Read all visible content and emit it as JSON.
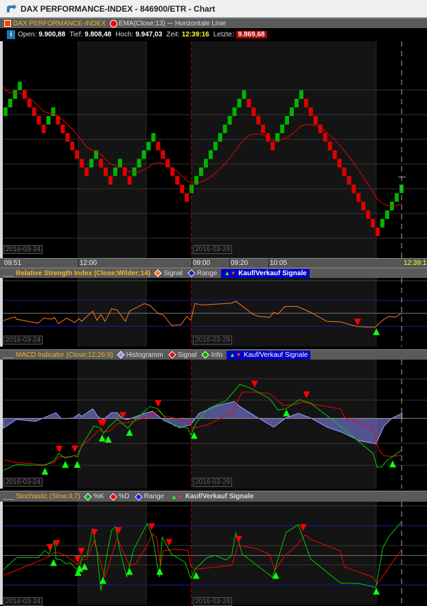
{
  "window": {
    "title": "DAX PERFORMANCE-INDEX - 846900/ETR - Chart"
  },
  "legend": {
    "instrument": "DAX PERFORMANCE-INDEX",
    "ema": "EMA(Close;13)",
    "hline": "Horizontale Linie",
    "colors": {
      "instrument": "#ff4400",
      "ema": "#ff0000",
      "hline": "#5aa0d0"
    }
  },
  "info": {
    "open_label": "Open:",
    "open": "9.900,88",
    "low_label": "Tief:",
    "low": "9.808,48",
    "high_label": "Hoch:",
    "high": "9.947,03",
    "time_label": "Zeit:",
    "time": "12:39:16",
    "last_label": "Letzte:",
    "last": "9.869,68"
  },
  "dates": {
    "d1": "2016-03-24",
    "d2": "2016-03-29"
  },
  "time_axis": [
    "09:51",
    "12:00",
    "09:00",
    "09:20",
    "10:05",
    "12:39:1"
  ],
  "renko": {
    "start_level": -3,
    "runs": [
      [
        1,
        4
      ],
      [
        -1,
        5
      ],
      [
        1,
        2
      ],
      [
        -1,
        7
      ],
      [
        1,
        2
      ],
      [
        -1,
        3
      ],
      [
        1,
        2
      ],
      [
        -1,
        2
      ],
      [
        1,
        5
      ],
      [
        -1,
        7
      ],
      [
        1,
        12
      ],
      [
        -1,
        6
      ],
      [
        1,
        6
      ],
      [
        -1,
        16
      ],
      [
        1,
        5
      ]
    ],
    "up_color": "#00b400",
    "down_color": "#e00000",
    "ema_period": 13
  },
  "rsi": {
    "title": "Relative Strength Index (Close;Wilder;14)",
    "signal": "Signal",
    "range": "Range",
    "signals": "Kauf/Verkauf Signale",
    "range_levels": [
      30,
      70
    ],
    "series": [
      [
        0.8,
        38.8
      ],
      [
        3.7,
        44.4
      ],
      [
        4,
        40.9
      ],
      [
        9.3,
        34.6
      ],
      [
        10.7,
        42.3
      ],
      [
        12.7,
        40.9
      ],
      [
        13.3,
        43.7
      ],
      [
        14.3,
        33.9
      ],
      [
        16.3,
        42.3
      ],
      [
        18.3,
        35.6
      ],
      [
        19.3,
        41.6
      ],
      [
        20,
        37.4
      ],
      [
        22.7,
        53.2
      ],
      [
        23.7,
        39.1
      ],
      [
        24.7,
        47.9
      ],
      [
        25.7,
        37.4
      ],
      [
        27.3,
        56.7
      ],
      [
        28.7,
        54.9
      ],
      [
        30.7,
        37.4
      ],
      [
        31.7,
        53.2
      ],
      [
        35.3,
        64.7
      ],
      [
        36.7,
        61.9
      ],
      [
        38.7,
        49.6
      ],
      [
        40,
        47.2
      ],
      [
        42,
        31.1
      ],
      [
        44.3,
        32.1
      ],
      [
        45.7,
        45.1
      ],
      [
        46.7,
        39.1
      ],
      [
        47.7,
        64.7
      ],
      [
        49.7,
        62.6
      ],
      [
        56.7,
        65.4
      ],
      [
        57.7,
        68.2
      ],
      [
        58.7,
        63.7
      ],
      [
        62,
        47.9
      ],
      [
        63.3,
        45.1
      ],
      [
        66,
        43.7
      ],
      [
        67,
        51.4
      ],
      [
        68,
        48.6
      ],
      [
        69.7,
        60.2
      ],
      [
        72.7,
        60.5
      ],
      [
        76,
        51.4
      ],
      [
        80,
        37.4
      ],
      [
        83.3,
        36.7
      ],
      [
        87.3,
        29.6
      ],
      [
        91.7,
        28.2
      ],
      [
        92.7,
        33.9
      ],
      [
        94,
        40.9
      ],
      [
        95.3,
        45.1
      ],
      [
        96.7,
        43.7
      ],
      [
        98.4,
        50.4
      ]
    ],
    "markers": [
      {
        "idx": 87.5,
        "value": 30,
        "type": "sell"
      },
      {
        "idx": 92.1,
        "value": 28,
        "type": "buy"
      }
    ]
  },
  "macd": {
    "title": "MACD Indicator (Close;12;26;9)",
    "histogram": "Histogramm",
    "signal": "Signal",
    "info": "Info",
    "signals": "Kauf/Verkauf Signale",
    "histogram_series": [
      [
        0.8,
        -4.3
      ],
      [
        4,
        -0.5
      ],
      [
        8.7,
        -1.3
      ],
      [
        11.3,
        0.7
      ],
      [
        13.7,
        2.5
      ],
      [
        15,
        -0.1
      ],
      [
        18,
        0.2
      ],
      [
        19.3,
        1.9
      ],
      [
        20,
        0.9
      ],
      [
        22.7,
        4.2
      ],
      [
        24,
        0.7
      ],
      [
        25.3,
        -0.5
      ],
      [
        27.3,
        2.5
      ],
      [
        28.7,
        2.5
      ],
      [
        30,
        -0.1
      ],
      [
        31.3,
        -0.5
      ],
      [
        35.3,
        2.2
      ],
      [
        37.3,
        3.2
      ],
      [
        40,
        -0.8
      ],
      [
        44,
        -4.1
      ],
      [
        46.7,
        -2.8
      ],
      [
        48.7,
        2.2
      ],
      [
        53.3,
        5.7
      ],
      [
        57.3,
        7.4
      ],
      [
        58.7,
        5.2
      ],
      [
        62.7,
        0.7
      ],
      [
        67,
        -3.8
      ],
      [
        70,
        0.2
      ],
      [
        73,
        2.2
      ],
      [
        76,
        0.2
      ],
      [
        80,
        -3.8
      ],
      [
        84,
        -6.3
      ],
      [
        88,
        -9.8
      ],
      [
        92,
        -11.1
      ],
      [
        94,
        -3.3
      ],
      [
        96,
        0.2
      ],
      [
        98.4,
        2.2
      ]
    ],
    "signal_series": [
      [
        0.8,
        -18
      ],
      [
        4,
        -19.3
      ],
      [
        10.7,
        -20.3
      ],
      [
        13.3,
        -19.3
      ],
      [
        14.3,
        -16.8
      ],
      [
        17.3,
        -16.8
      ],
      [
        19,
        -15.8
      ],
      [
        20,
        -12.3
      ],
      [
        23,
        -7.3
      ],
      [
        24,
        -5.3
      ],
      [
        26.7,
        -5.8
      ],
      [
        28.7,
        -2.3
      ],
      [
        31.3,
        -1.8
      ],
      [
        35.3,
        0.2
      ],
      [
        37.3,
        1.7
      ],
      [
        38.7,
        3.5
      ],
      [
        40,
        1.2
      ],
      [
        45.3,
        -0.8
      ],
      [
        47.3,
        -4.3
      ],
      [
        50.7,
        -2.8
      ],
      [
        56.7,
        2.2
      ],
      [
        58,
        7.2
      ],
      [
        59.3,
        11.5
      ],
      [
        62,
        11.5
      ],
      [
        66,
        10.9
      ],
      [
        69.3,
        5.7
      ],
      [
        72,
        6
      ],
      [
        74,
        7.2
      ],
      [
        76.7,
        6.2
      ],
      [
        83.3,
        4.2
      ],
      [
        84.3,
        0.5
      ],
      [
        91.3,
        -4.3
      ],
      [
        92.7,
        -13.8
      ],
      [
        94,
        -16.3
      ],
      [
        96,
        -16.7
      ],
      [
        98.4,
        -16.1
      ]
    ],
    "macd_series": [
      [
        0.8,
        -22.8
      ],
      [
        4,
        -20.1
      ],
      [
        8,
        -20.5
      ],
      [
        11,
        -20.5
      ],
      [
        13.3,
        -18.3
      ],
      [
        14.3,
        -15.3
      ],
      [
        16,
        -17.3
      ],
      [
        18,
        -16.3
      ],
      [
        19,
        -16.8
      ],
      [
        20,
        -11.8
      ],
      [
        23,
        -3.3
      ],
      [
        24.7,
        -4.3
      ],
      [
        25.3,
        -6.8
      ],
      [
        26.3,
        -4.3
      ],
      [
        28.7,
        -0.3
      ],
      [
        31.3,
        -4.3
      ],
      [
        32.7,
        -1.3
      ],
      [
        36.7,
        5.2
      ],
      [
        38.7,
        4.2
      ],
      [
        40.7,
        -0.3
      ],
      [
        42.7,
        -3.3
      ],
      [
        46,
        -4.3
      ],
      [
        46.7,
        -7.3
      ],
      [
        48,
        -1.8
      ],
      [
        51.3,
        4.7
      ],
      [
        55.3,
        7.7
      ],
      [
        58.7,
        14.9
      ],
      [
        61.3,
        13.2
      ],
      [
        66,
        8.7
      ],
      [
        68,
        3.7
      ],
      [
        70,
        4.2
      ],
      [
        73.3,
        8.2
      ],
      [
        76,
        6.7
      ],
      [
        83.3,
        -3.3
      ],
      [
        91.3,
        -15.3
      ],
      [
        92.3,
        -21.3
      ],
      [
        93.3,
        -21.3
      ],
      [
        94.7,
        -18.3
      ],
      [
        98.4,
        -13.8
      ]
    ],
    "markers": [
      {
        "idx": 14.5,
        "value": -15.3,
        "type": "sell"
      },
      {
        "idx": 18.3,
        "value": -15.1,
        "type": "sell"
      },
      {
        "idx": 24.7,
        "value": -3.8,
        "type": "sell"
      },
      {
        "idx": 25.3,
        "value": -3.8,
        "type": "sell"
      },
      {
        "idx": 30.1,
        "value": -0.5,
        "type": "sell"
      },
      {
        "idx": 38.7,
        "value": 4.7,
        "type": "sell"
      },
      {
        "idx": 62.3,
        "value": 13.2,
        "type": "sell"
      },
      {
        "idx": 75,
        "value": 8.5,
        "type": "sell"
      },
      {
        "idx": 11,
        "value": -21.3,
        "type": "buy"
      },
      {
        "idx": 16,
        "value": -18.3,
        "type": "buy"
      },
      {
        "idx": 18.9,
        "value": -18.3,
        "type": "buy"
      },
      {
        "idx": 25,
        "value": -6.8,
        "type": "buy"
      },
      {
        "idx": 26.5,
        "value": -7.3,
        "type": "buy"
      },
      {
        "idx": 31.7,
        "value": -4.3,
        "type": "buy"
      },
      {
        "idx": 47.5,
        "value": -5.6,
        "type": "buy"
      },
      {
        "idx": 70.1,
        "value": 4.2,
        "type": "buy"
      },
      {
        "idx": 96.1,
        "value": -18.1,
        "type": "buy"
      }
    ]
  },
  "stoch": {
    "title": "Stochastic (Slow;4;7)",
    "k": "%K",
    "d": "%D",
    "range": "Range",
    "signals": "Kauf/Verkauf Signale",
    "range_levels": [
      20,
      80
    ],
    "k_series": [
      [
        0.8,
        35.4
      ],
      [
        4,
        47.7
      ],
      [
        6,
        48.1
      ],
      [
        9.3,
        47.7
      ],
      [
        11,
        55.3
      ],
      [
        12,
        51.2
      ],
      [
        13.3,
        65.7
      ],
      [
        13.7,
        46.5
      ],
      [
        15,
        45.4
      ],
      [
        16,
        41.9
      ],
      [
        17.3,
        42.4
      ],
      [
        18.7,
        36.1
      ],
      [
        19.7,
        40.7
      ],
      [
        20,
        47.7
      ],
      [
        21.3,
        50
      ],
      [
        22.7,
        77.1
      ],
      [
        23.7,
        54.6
      ],
      [
        24.7,
        14.1
      ],
      [
        25.3,
        28
      ],
      [
        26.3,
        53.5
      ],
      [
        27.3,
        75.5
      ],
      [
        28.3,
        78.9
      ],
      [
        29.3,
        55.8
      ],
      [
        31,
        28
      ],
      [
        32.7,
        55.8
      ],
      [
        36,
        82.4
      ],
      [
        37.3,
        69.7
      ],
      [
        39,
        28
      ],
      [
        39.7,
        68.5
      ],
      [
        42,
        51.2
      ],
      [
        45.3,
        43.1
      ],
      [
        46.7,
        26.9
      ],
      [
        48,
        37.3
      ],
      [
        50.7,
        47.7
      ],
      [
        52.7,
        50
      ],
      [
        55.3,
        45.4
      ],
      [
        56.7,
        50
      ],
      [
        57.7,
        73.1
      ],
      [
        59.3,
        51.2
      ],
      [
        66.7,
        28
      ],
      [
        70,
        73.1
      ],
      [
        73,
        81.3
      ],
      [
        76,
        46.5
      ],
      [
        83.3,
        22.2
      ],
      [
        88,
        21.5
      ],
      [
        92,
        17.6
      ],
      [
        93.7,
        58.1
      ],
      [
        95.3,
        69.7
      ],
      [
        98.4,
        84.7
      ]
    ],
    "d_series": [
      [
        0.8,
        29.9
      ],
      [
        4,
        35
      ],
      [
        8.7,
        43.1
      ],
      [
        12,
        48.8
      ],
      [
        13.3,
        53
      ],
      [
        14.7,
        52.3
      ],
      [
        16,
        50
      ],
      [
        19,
        40.7
      ],
      [
        20,
        45.4
      ],
      [
        21.3,
        46.5
      ],
      [
        23,
        65
      ],
      [
        25.7,
        28
      ],
      [
        28.7,
        67.4
      ],
      [
        31.7,
        39.6
      ],
      [
        33.3,
        41.9
      ],
      [
        36,
        60.4
      ],
      [
        37.3,
        72
      ],
      [
        38.3,
        68.5
      ],
      [
        39.3,
        39.6
      ],
      [
        40,
        54.6
      ],
      [
        42.7,
        56.3
      ],
      [
        46,
        55.3
      ],
      [
        46.7,
        38.4
      ],
      [
        48,
        36.1
      ],
      [
        53.3,
        38.4
      ],
      [
        56.7,
        40
      ],
      [
        58.3,
        60.4
      ],
      [
        62.7,
        56.9
      ],
      [
        66,
        51.2
      ],
      [
        67.3,
        35
      ],
      [
        69.7,
        50
      ],
      [
        72.7,
        60.4
      ],
      [
        74.7,
        70.8
      ],
      [
        76,
        66.2
      ],
      [
        83.3,
        54.6
      ],
      [
        84.3,
        38.4
      ],
      [
        91.3,
        28
      ],
      [
        92.3,
        21.1
      ],
      [
        94.7,
        35
      ],
      [
        98.4,
        56.9
      ]
    ],
    "markers": [
      {
        "idx": 12.2,
        "value": 54,
        "type": "sell"
      },
      {
        "idx": 13.9,
        "value": 58,
        "type": "sell"
      },
      {
        "idx": 19,
        "value": 42,
        "type": "sell"
      },
      {
        "idx": 19.9,
        "value": 50,
        "type": "sell"
      },
      {
        "idx": 23.1,
        "value": 69,
        "type": "sell"
      },
      {
        "idx": 29,
        "value": 71,
        "type": "sell"
      },
      {
        "idx": 37.1,
        "value": 75,
        "type": "sell"
      },
      {
        "idx": 41.4,
        "value": 59,
        "type": "sell"
      },
      {
        "idx": 58.4,
        "value": 62,
        "type": "sell"
      },
      {
        "idx": 74.2,
        "value": 74,
        "type": "sell"
      },
      {
        "idx": 13.1,
        "value": 47,
        "type": "buy"
      },
      {
        "idx": 19.1,
        "value": 37,
        "type": "buy"
      },
      {
        "idx": 19.5,
        "value": 41,
        "type": "buy"
      },
      {
        "idx": 20.7,
        "value": 43,
        "type": "buy"
      },
      {
        "idx": 25.2,
        "value": 29,
        "type": "buy"
      },
      {
        "idx": 31.7,
        "value": 38,
        "type": "buy"
      },
      {
        "idx": 39.1,
        "value": 38,
        "type": "buy"
      },
      {
        "idx": 48,
        "value": 34,
        "type": "buy"
      },
      {
        "idx": 67.5,
        "value": 34,
        "type": "buy"
      },
      {
        "idx": 92.1,
        "value": 18,
        "type": "buy"
      }
    ]
  }
}
